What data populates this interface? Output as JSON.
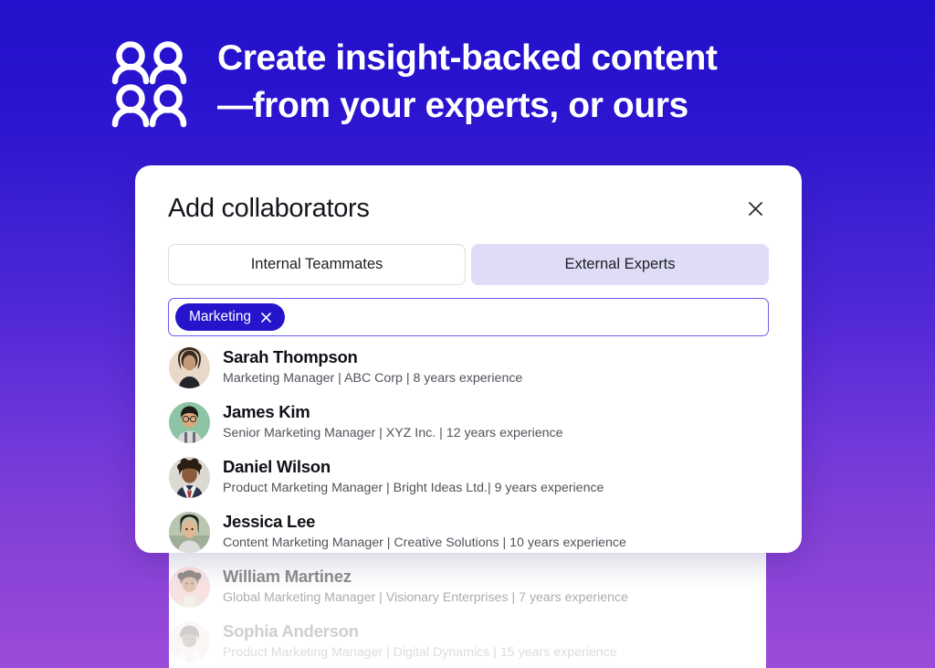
{
  "hero": {
    "icon": "people-group-icon",
    "title": "Create insight-backed content\n—from your experts, or ours"
  },
  "colors": {
    "bg_top": "#2211CC",
    "bg_bottom": "#9B4BD8",
    "accent": "#2414CC",
    "tab_active_bg": "#DEDCF7",
    "input_border": "#6A5AF0",
    "card_bg": "#FFFFFF"
  },
  "modal": {
    "title": "Add collaborators",
    "close_icon": "close-icon",
    "tabs": [
      {
        "label": "Internal Teammates",
        "active": false
      },
      {
        "label": "External Experts",
        "active": true
      }
    ],
    "search": {
      "chips": [
        {
          "label": "Marketing",
          "remove_icon": "close-icon"
        }
      ],
      "placeholder": "",
      "value": ""
    },
    "results": [
      {
        "name": "Sarah Thompson",
        "meta": "Marketing Manager | ABC Corp | 8 years experience",
        "role": "Marketing Manager",
        "company": "ABC Corp",
        "experience": "8 years experience",
        "avatar_bg": "#e8d9c8",
        "fade": 0
      },
      {
        "name": "James Kim",
        "meta": "Senior Marketing Manager | XYZ Inc. | 12 years experience",
        "role": "Senior Marketing Manager",
        "company": "XYZ Inc.",
        "experience": "12 years experience",
        "avatar_bg": "#8cc4a4",
        "fade": 0
      },
      {
        "name": "Daniel Wilson",
        "meta": "Product Marketing Manager | Bright Ideas Ltd.| 9 years experience",
        "role": "Product Marketing Manager",
        "company": "Bright Ideas Ltd.",
        "experience": "9 years experience",
        "avatar_bg": "#dcd8d2",
        "fade": 0
      },
      {
        "name": "Jessica Lee",
        "meta": "Content Marketing Manager | Creative Solutions | 10 years experience",
        "role": "Content Marketing Manager",
        "company": "Creative Solutions",
        "experience": "10 years experience",
        "avatar_bg": "#b9c7b0",
        "fade": 0
      },
      {
        "name": "William Martinez",
        "meta": "Global Marketing Manager | Visionary Enterprises | 7 years experience",
        "role": "Global Marketing Manager",
        "company": "Visionary Enterprises",
        "experience": "7 years experience",
        "avatar_bg": "#f0c2c2",
        "fade": 1
      },
      {
        "name": "Sophia Anderson",
        "meta": "Product Marketing Manager | Digital Dynamics | 15 years experience",
        "role": "Product Marketing Manager",
        "company": "Digital Dynamics",
        "experience": "15 years experience",
        "avatar_bg": "#f2d8d8",
        "fade": 2
      }
    ]
  }
}
